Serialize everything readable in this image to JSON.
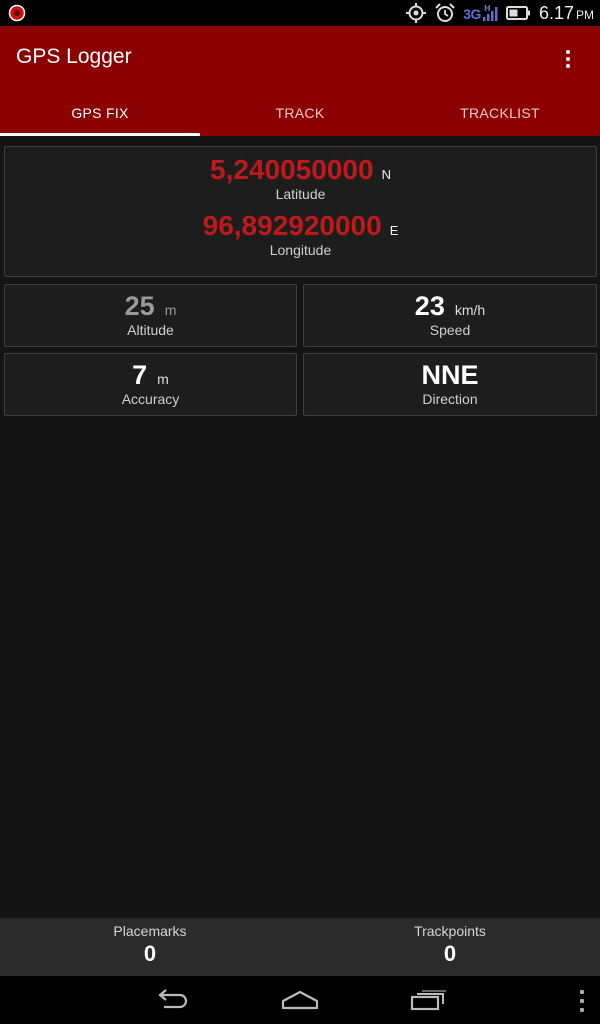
{
  "status_bar": {
    "network": "3G",
    "network_sub": "H",
    "time": "6.17",
    "ampm": "PM",
    "icons": [
      "record-icon",
      "location-icon",
      "alarm-icon",
      "signal-icon",
      "battery-icon"
    ]
  },
  "app": {
    "title": "GPS Logger",
    "accent_color": "#8b0000"
  },
  "tabs": [
    {
      "label": "GPS FIX",
      "active": true
    },
    {
      "label": "TRACK",
      "active": false
    },
    {
      "label": "TRACKLIST",
      "active": false
    }
  ],
  "fix": {
    "latitude": {
      "value": "5,240050000",
      "hemisphere": "N",
      "label": "Latitude"
    },
    "longitude": {
      "value": "96,892920000",
      "hemisphere": "E",
      "label": "Longitude"
    },
    "altitude": {
      "value": "25",
      "unit": "m",
      "label": "Altitude"
    },
    "speed": {
      "value": "23",
      "unit": "km/h",
      "label": "Speed"
    },
    "accuracy": {
      "value": "7",
      "unit": "m",
      "label": "Accuracy"
    },
    "direction": {
      "value": "NNE",
      "label": "Direction"
    }
  },
  "counters": {
    "placemarks": {
      "label": "Placemarks",
      "value": "0"
    },
    "trackpoints": {
      "label": "Trackpoints",
      "value": "0"
    }
  }
}
